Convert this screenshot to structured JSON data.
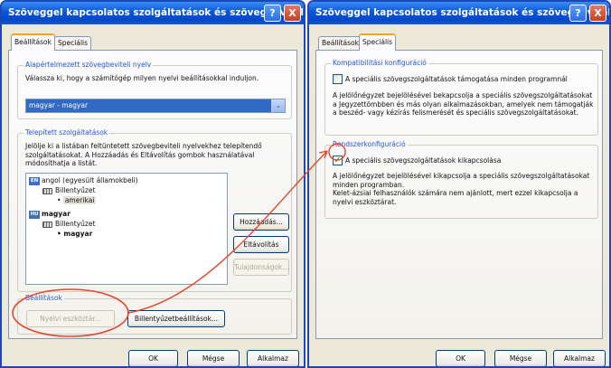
{
  "left_window": {
    "title": "Szöveggel kapcsolatos szolgáltatások és szövegbevitel...",
    "help_button": "?",
    "close_button": "X",
    "tabs": [
      "Beállítások",
      "Speciális"
    ],
    "default_language_group": {
      "legend": "Alapértelmezett szövegbeviteli nyelv",
      "description": "Válassza ki, hogy a számítógép milyen nyelvi beállításokkal induljon.",
      "selected_value": "magyar - magyar",
      "dropdown_arrow": "⌄"
    },
    "installed_group": {
      "legend": "Telepített szolgáltatások",
      "description": "Jelölje ki a listában feltüntetett szövegbeviteli nyelvekhez telepítendő szolgáltatásokat. A Hozzáadás és Eltávolítás gombok használatával módosíthatja a listát.",
      "tree": [
        {
          "badge": "EN",
          "language": "angol (egyesült államokbeli)",
          "keyboard_label": "Billentyűzet",
          "layout": "amerikai"
        },
        {
          "badge": "HU",
          "language": "magyar",
          "keyboard_label": "Billentyűzet",
          "layout": "magyar"
        }
      ],
      "add_button": "Hozzáadás...",
      "remove_button": "Eltávolítás",
      "properties_button": "Tulajdonságok..."
    },
    "settings_group": {
      "legend": "Beállítások",
      "language_bar_button": "Nyelvi eszköztár...",
      "key_settings_button": "Billentyűzetbeállítások..."
    },
    "footer": {
      "ok": "OK",
      "cancel": "Mégse",
      "apply": "Alkalmaz"
    }
  },
  "right_window": {
    "title": "Szöveggel kapcsolatos szolgáltatások és szövegbevitel...",
    "help_button": "?",
    "close_button": "X",
    "tabs": [
      "Beállítások",
      "Speciális"
    ],
    "compat_group": {
      "legend": "Kompatibilitási konfiguráció",
      "checkbox_label": "A speciális szövegszolgáltatások támogatása minden programnál",
      "checked": false,
      "description": "A jelölőnégyzet bejelölésével bekapcsolja a speciális szövegszolgáltatásokat a Jegyzettömbben és más olyan alkalmazásokban, amelyek nem támogatják a beszéd- vagy kézírás felismerését és speciális szövegszolgáltatásokat."
    },
    "system_group": {
      "legend": "Rendszerkonfiguráció",
      "checkbox_label": "A speciális szövegszolgáltatások kikapcsolása",
      "checked": true,
      "check_mark": "✓",
      "description": "A jelölőnégyzet bejelölésével kikapcsolja a speciális szövegszolgáltatásokat minden programban.\nKelet-ázsiai felhasználók számára nem ajánlott, mert ezzel kikapcsolja a nyelvi eszköztárat."
    },
    "footer": {
      "ok": "OK",
      "cancel": "Mégse",
      "apply": "Alkalmaz"
    }
  },
  "colors": {
    "title_bar": "#0a56d8",
    "dialog_bg": "#ece9d8",
    "group_legend": "#2a58d6",
    "selection": "#316ac5",
    "annotation": "#e8442a",
    "active_tab_accent": "#f3a528"
  }
}
